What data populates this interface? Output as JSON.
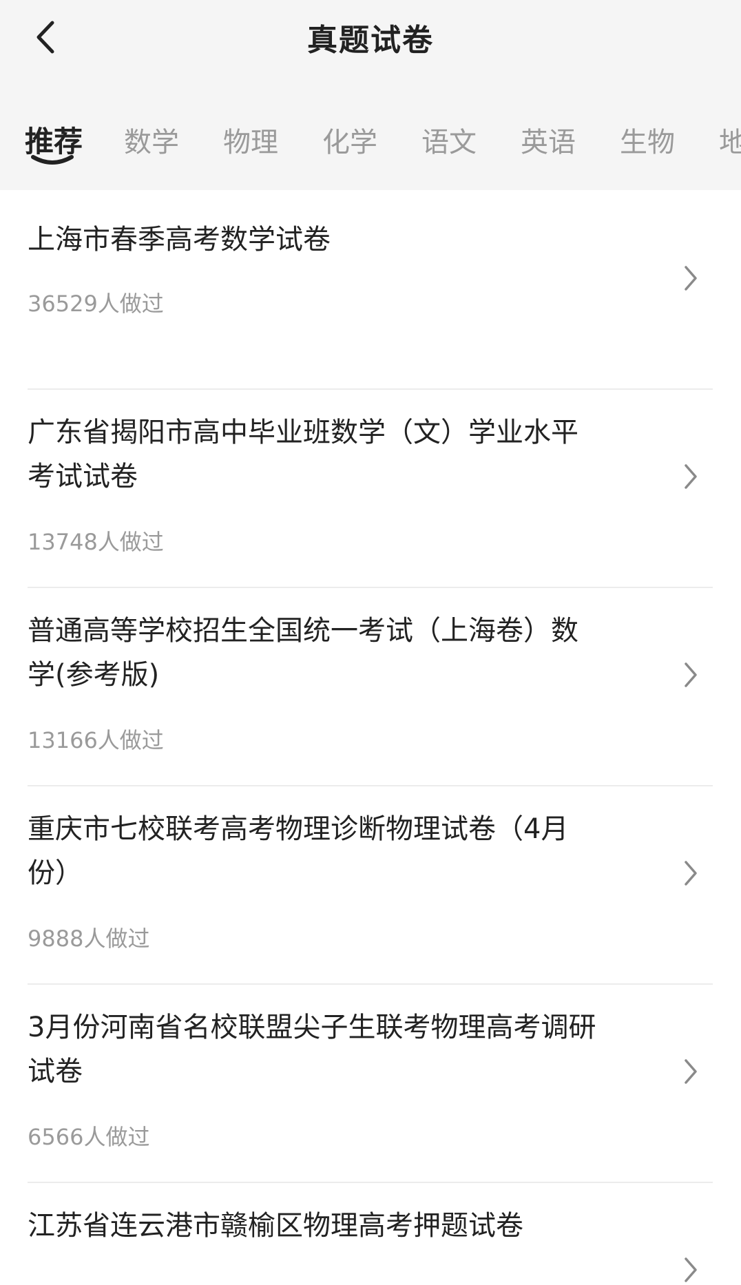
{
  "header": {
    "title": "真题试卷",
    "back_icon": "chevron-left-icon"
  },
  "tabs": [
    {
      "label": "推荐",
      "active": true
    },
    {
      "label": "数学",
      "active": false
    },
    {
      "label": "物理",
      "active": false
    },
    {
      "label": "化学",
      "active": false
    },
    {
      "label": "语文",
      "active": false
    },
    {
      "label": "英语",
      "active": false
    },
    {
      "label": "生物",
      "active": false
    },
    {
      "label": "地",
      "active": false
    }
  ],
  "papers": [
    {
      "title_line1": "上海市春季高考数学试卷",
      "title_line2": "",
      "count": "36529人做过"
    },
    {
      "title_line1": "广东省揭阳市高中毕业班数学（文）学业水平",
      "title_line2": "考试试卷",
      "count": "13748人做过"
    },
    {
      "title_line1": "普通高等学校招生全国统一考试（上海卷）数",
      "title_line2": "学(参考版)",
      "count": "13166人做过"
    },
    {
      "title_line1": "重庆市七校联考高考物理诊断物理试卷（4月",
      "title_line2": "份）",
      "count": "9888人做过"
    },
    {
      "title_line1": "3月份河南省名校联盟尖子生联考物理高考调研",
      "title_line2": "试卷",
      "count": "6566人做过"
    },
    {
      "title_line1": "江苏省连云港市赣榆区物理高考押题试卷",
      "title_line2": "",
      "count": ""
    }
  ],
  "colors": {
    "header_bg": "#f5f5f5",
    "text_primary": "#222222",
    "text_secondary": "#9a9a9a",
    "divider": "#ececec"
  }
}
